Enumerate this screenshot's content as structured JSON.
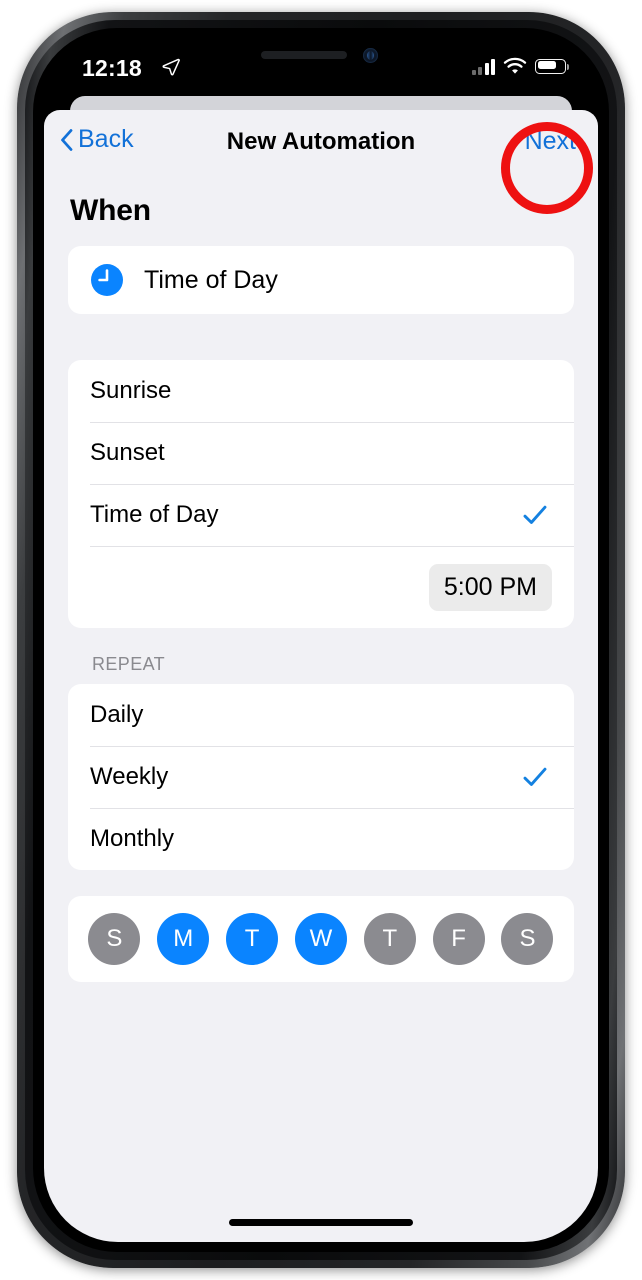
{
  "status_bar": {
    "time": "12:18",
    "location_icon": "location-arrow-icon",
    "cellular_icon": "cellular-bars-icon",
    "wifi_icon": "wifi-icon",
    "battery_icon": "battery-icon",
    "battery_level_pct": 66
  },
  "navbar": {
    "back_label": "Back",
    "title": "New Automation",
    "next_label": "Next"
  },
  "main": {
    "section_title": "When",
    "trigger": {
      "icon": "clock-icon",
      "label": "Time of Day"
    },
    "time_options": [
      {
        "label": "Sunrise",
        "selected": false
      },
      {
        "label": "Sunset",
        "selected": false
      },
      {
        "label": "Time of Day",
        "selected": true
      }
    ],
    "time_value": "5:00 PM",
    "repeat_header": "REPEAT",
    "repeat_options": [
      {
        "label": "Daily",
        "selected": false
      },
      {
        "label": "Weekly",
        "selected": true
      },
      {
        "label": "Monthly",
        "selected": false
      }
    ],
    "days": [
      {
        "label": "S",
        "selected": false
      },
      {
        "label": "M",
        "selected": true
      },
      {
        "label": "T",
        "selected": true
      },
      {
        "label": "W",
        "selected": true
      },
      {
        "label": "T",
        "selected": false
      },
      {
        "label": "F",
        "selected": false
      },
      {
        "label": "S",
        "selected": false
      }
    ]
  },
  "annotation": {
    "shape": "circle",
    "color": "#ee1111",
    "target": "next-button"
  },
  "colors": {
    "accent_blue": "#0a84ff",
    "link_blue": "#1271d8",
    "day_off_gray": "#8b8b90",
    "background": "#f1f1f5",
    "card": "#ffffff"
  }
}
